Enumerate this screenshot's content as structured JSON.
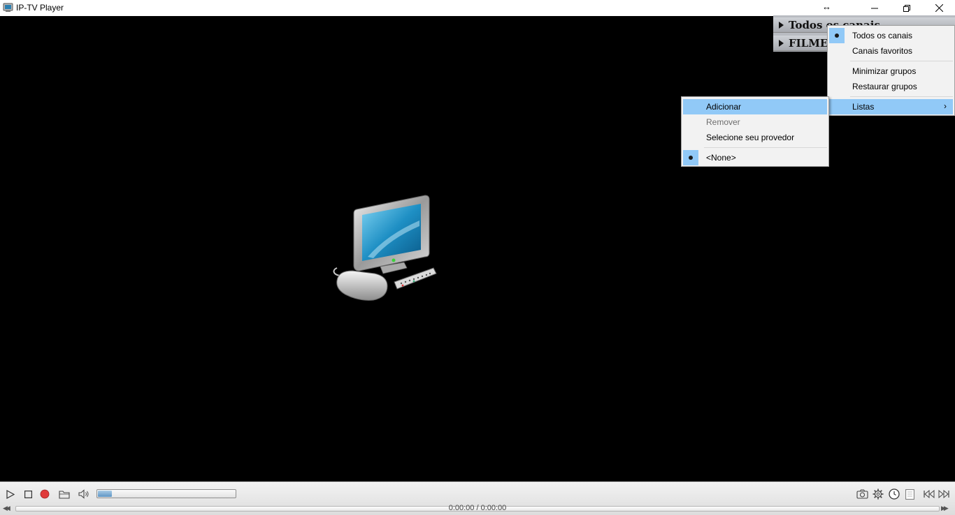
{
  "window": {
    "title": "IP-TV Player",
    "controls": [
      "minimize",
      "maximize",
      "close"
    ]
  },
  "groups": [
    {
      "label": "Todos os canais"
    },
    {
      "label": "FILMES"
    }
  ],
  "context_menu": {
    "items": [
      {
        "label": "Todos os canais",
        "checked": true
      },
      {
        "label": "Canais favoritos"
      },
      {
        "label": "Minimizar grupos"
      },
      {
        "label": "Restaurar grupos"
      },
      {
        "label": "Listas",
        "highlighted": true,
        "has_submenu": true
      }
    ]
  },
  "submenu_listas": {
    "items": [
      {
        "label": "Adicionar",
        "highlighted": true
      },
      {
        "label": "Remover",
        "disabled": true
      },
      {
        "label": "Selecione seu provedor"
      },
      {
        "label": "<None>",
        "checked": true
      }
    ]
  },
  "player": {
    "time_display": "0:00:00 / 0:00:00",
    "volume_level": 0.1,
    "record_color": "#e03b3b",
    "accent_color": "#91c9f7"
  },
  "icons": {
    "toolbar_left": [
      "play-icon",
      "stop-icon",
      "record-icon",
      "open-folder-icon",
      "speaker-icon"
    ],
    "toolbar_right": [
      "camera-icon",
      "gear-icon",
      "clock-icon",
      "playlist-icon",
      "previous-channel-icon",
      "next-channel-icon"
    ]
  }
}
